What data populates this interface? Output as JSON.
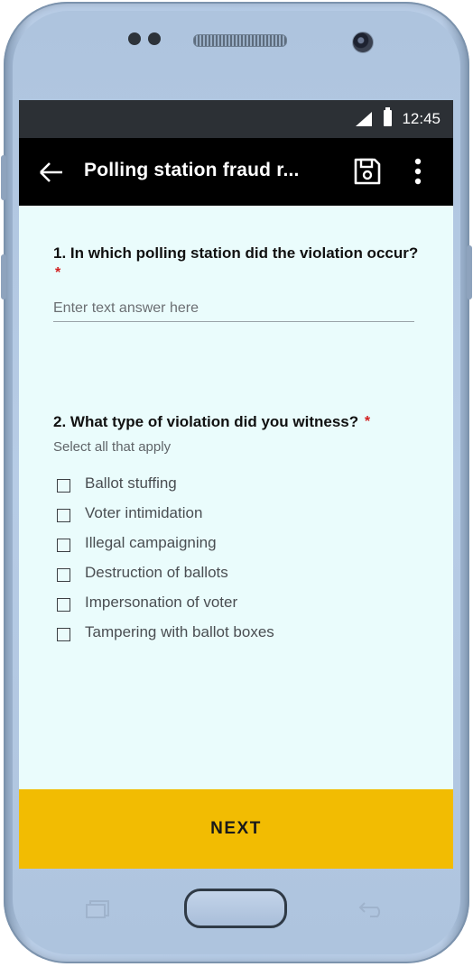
{
  "status_bar": {
    "time": "12:45",
    "signal_icon": "signal-icon",
    "battery_icon": "battery-icon"
  },
  "app_bar": {
    "title": "Polling station fraud r...",
    "back_icon": "arrow-left-icon",
    "save_icon": "save-icon",
    "more_icon": "more-vertical-icon"
  },
  "form": {
    "question1": {
      "text": "1. In which polling station did the violation occur?",
      "required_mark": "*",
      "placeholder": "Enter text answer here",
      "value": ""
    },
    "question2": {
      "text": "2. What type of violation did you witness?",
      "required_mark": "*",
      "hint": "Select all that apply",
      "options": [
        {
          "label": "Ballot stuffing",
          "checked": false
        },
        {
          "label": "Voter intimidation",
          "checked": false
        },
        {
          "label": "Illegal campaigning",
          "checked": false
        },
        {
          "label": "Destruction of ballots",
          "checked": false
        },
        {
          "label": "Impersonation of voter",
          "checked": false
        },
        {
          "label": "Tampering with ballot boxes",
          "checked": false
        }
      ]
    }
  },
  "footer": {
    "next_label": "NEXT"
  },
  "colors": {
    "app_bar": "#000000",
    "status_bar": "#2c3035",
    "screen_background": "#eafcfc",
    "accent": "#f2bc02",
    "required": "#d22020"
  }
}
